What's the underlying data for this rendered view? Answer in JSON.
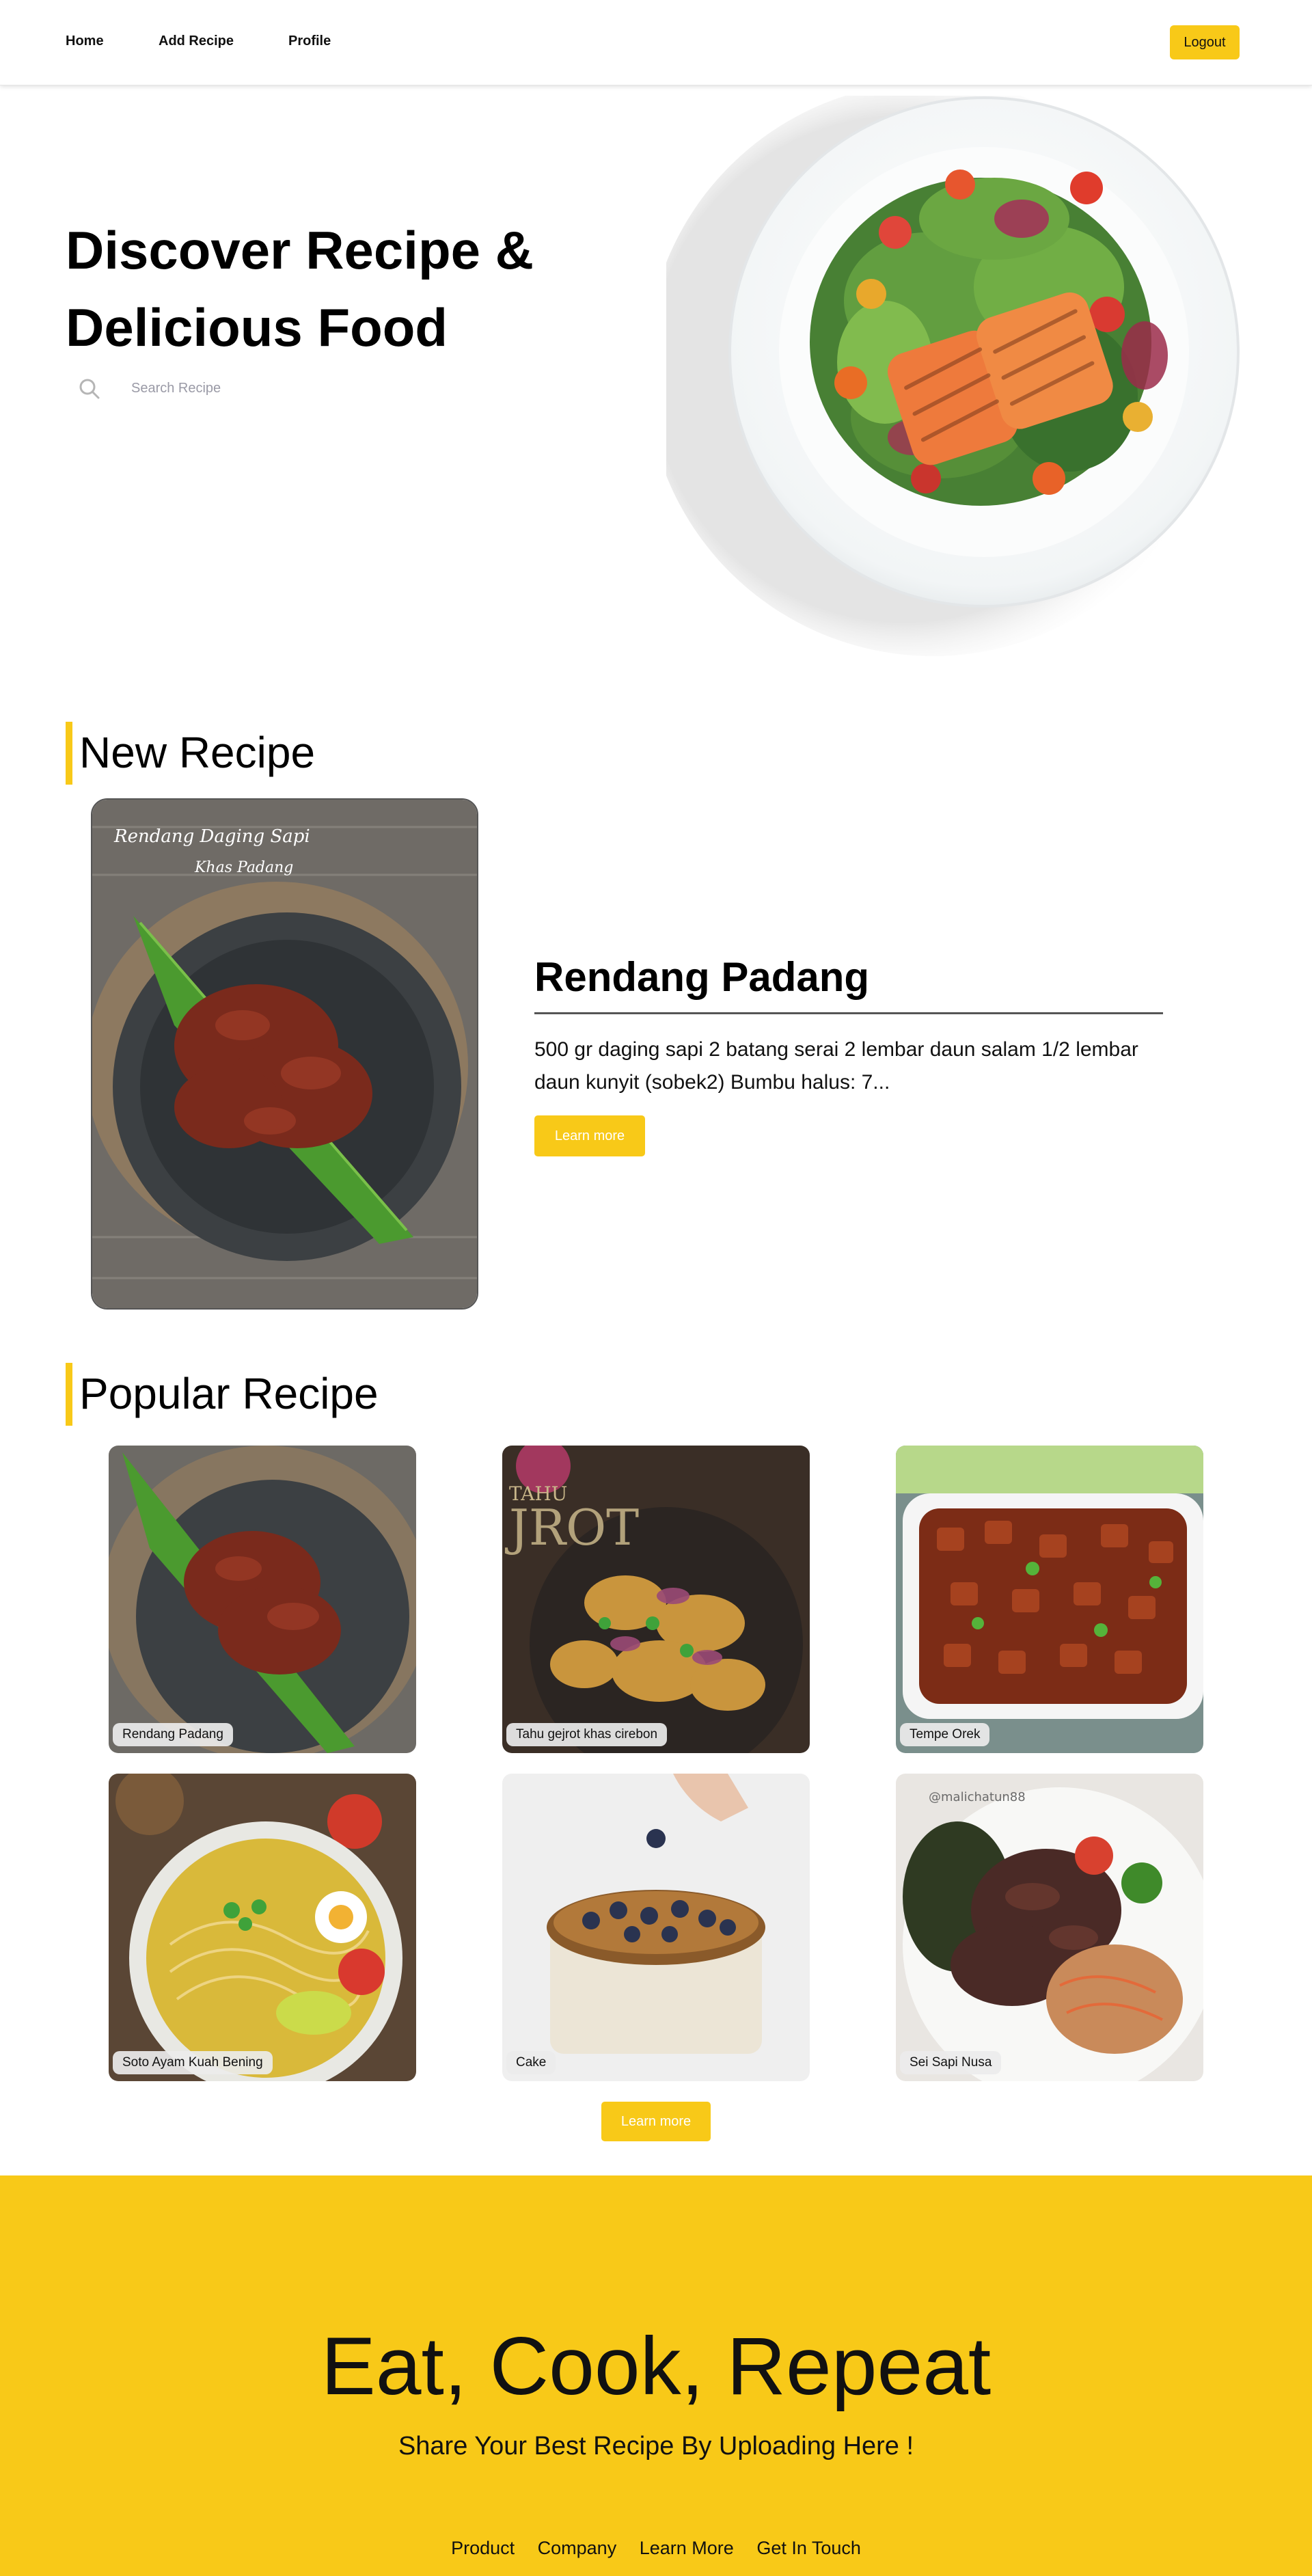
{
  "nav": {
    "home": "Home",
    "add_recipe": "Add Recipe",
    "profile": "Profile",
    "logout": "Logout"
  },
  "hero": {
    "title_line1": "Discover Recipe &",
    "title_line2": "Delicious Food",
    "search_placeholder": "Search Recipe"
  },
  "new_recipe": {
    "heading": "New Recipe",
    "title": "Rendang Padang",
    "description": "500 gr daging sapi 2 batang serai 2 lembar daun salam 1/2 lembar daun kunyit (sobek2) Bumbu halus: 7...",
    "button": "Learn more",
    "image_caption_line1": "Rendang Daging Sapi",
    "image_caption_line2": "Khas Padang"
  },
  "popular": {
    "heading": "Popular Recipe",
    "items": [
      {
        "label": "Rendang Padang"
      },
      {
        "label": "Tahu gejrot khas cirebon"
      },
      {
        "label": "Tempe Orek"
      },
      {
        "label": "Soto Ayam Kuah Bening"
      },
      {
        "label": "Cake"
      },
      {
        "label": "Sei Sapi Nusa"
      }
    ],
    "watermark_2": "TAHU",
    "watermark_2b": "JROT",
    "watermark_6": "@malichatun88",
    "button": "Learn more"
  },
  "footer": {
    "title": "Eat, Cook, Repeat",
    "subtitle": "Share Your Best Recipe By Uploading Here !",
    "links": [
      "Product",
      "Company",
      "Learn More",
      "Get In Touch"
    ]
  },
  "colors": {
    "accent": "#f8c918",
    "text": "#111111"
  }
}
